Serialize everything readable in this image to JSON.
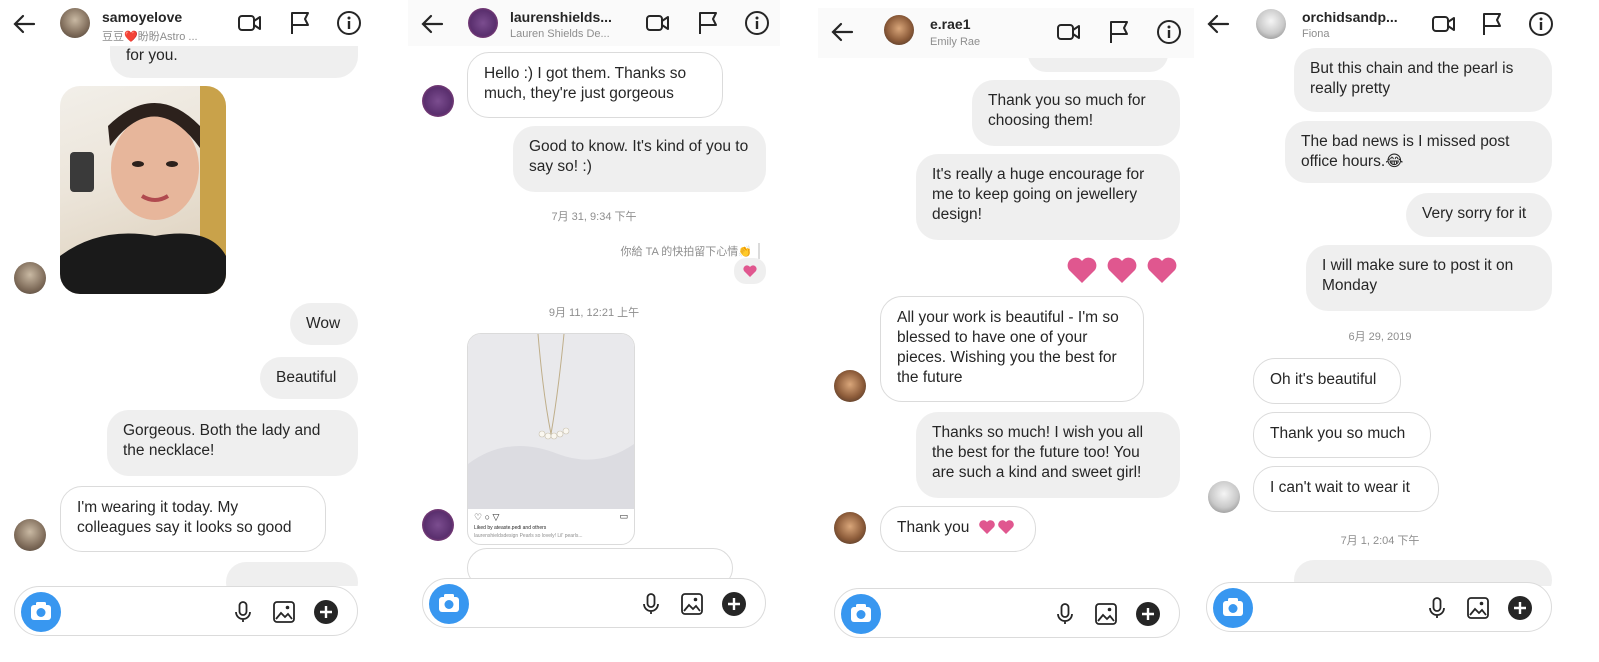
{
  "panels": [
    {
      "username": "samoyelove",
      "subtitle": "豆豆❤️盼盼Astro ...",
      "messages": {
        "m0": "for you.",
        "m1": "Wow",
        "m2": "Beautiful",
        "m3": "Gorgeous.  Both the lady and the necklace!",
        "m4": "I'm wearing it today. My colleagues say it looks so good"
      }
    },
    {
      "username": "laurenshields...",
      "subtitle": "Lauren Shields De...",
      "messages": {
        "m0": "Hello :) I got them. Thanks so much, they're just gorgeous",
        "m1": "Good to know. It's kind of you to say so! :)",
        "ts1": "7月 31, 9:34 下午",
        "reply_note": "你給 TA 的快拍留下心情👏",
        "ts2": "9月 11, 12:21 上午",
        "post_caption": "Liked by ateaste.pedi and others",
        "post_caption2": "laurenshieldsdesign  Pearls so lovely! Lil' pearls..."
      }
    },
    {
      "username": "e.rae1",
      "subtitle": "Emily Rae",
      "messages": {
        "m0": "Thank you so much for choosing them!",
        "m1": "It's really a huge encourage for me to keep going on jewellery design!",
        "m2": "All your work is beautiful - I'm so blessed to have one of your pieces. Wishing you the best for the future",
        "m3": "Thanks so much! I wish you all the best for the future too! You are such a kind and sweet girl!",
        "m4": "Thank you"
      }
    },
    {
      "username": "orchidsandp...",
      "subtitle": "Fiona",
      "messages": {
        "m0": "But this chain and the pearl is really pretty",
        "m1": "The bad news is  I missed post office hours.😂",
        "m2": "Very sorry for it",
        "m3": "I will make sure to post it on Monday",
        "ts1": "6月 29, 2019",
        "m4": "Oh it's beautiful",
        "m5": "Thank you so much",
        "m6": "I can't wait to wear it",
        "ts2": "7月 1, 2:04 下午"
      }
    }
  ],
  "colors": {
    "heart": "#e0578f",
    "camera": "#3897f0",
    "bubble_me": "#efefef",
    "border": "#dbdbdb"
  }
}
